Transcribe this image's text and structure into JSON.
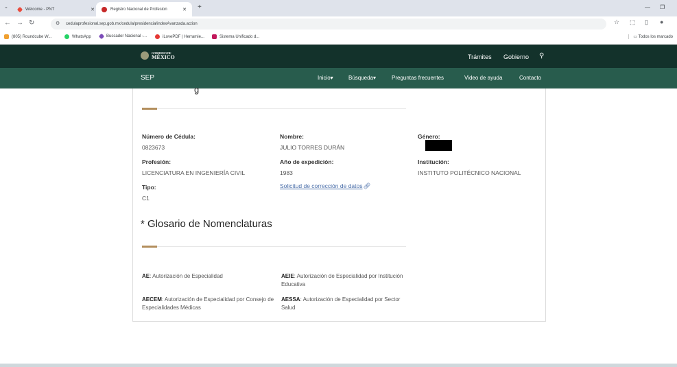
{
  "browser": {
    "tabs": [
      {
        "label": "Welcome - PNT",
        "active": false
      },
      {
        "label": "Registro Nacional de Profesion",
        "active": true
      }
    ],
    "url": "cedulaprofesional.sep.gob.mx/cedula/presidencia/indexAvanzada.action",
    "bookmarks": [
      "(805) Roundcube W...",
      "WhatsApp",
      "Buscador Nacional -...",
      "iLovePDF | Herramie...",
      "Sistema Unificado d..."
    ],
    "all_bookmarks": "Todos los marcado"
  },
  "header": {
    "logo_small": "GOBIERNO DE",
    "logo_main": "MÉXICO",
    "links": [
      "Trámites",
      "Gobierno"
    ],
    "sep": "SEP",
    "menu": [
      "Inicio▾",
      "Búsqueda▾",
      "Preguntas frecuentes",
      "Video de ayuda",
      "Contacto"
    ]
  },
  "record": {
    "heading_fragment": "g",
    "cedula_label": "Número de Cédula:",
    "cedula_value": "0823673",
    "nombre_label": "Nombre:",
    "nombre_value": "JULIO TORRES DURÁN",
    "genero_label": "Género:",
    "profesion_label": "Profesión:",
    "profesion_value": "LICENCIATURA EN INGENIERÍA CIVIL",
    "anio_label": "Año de expedición:",
    "anio_value": "1983",
    "institucion_label": "Institución:",
    "institucion_value": "INSTITUTO POLITÉCNICO NACIONAL",
    "tipo_label": "Tipo:",
    "tipo_value": "C1",
    "correction_link": "Solicitud de corrección de datos"
  },
  "glossary": {
    "title": "* Glosario de Nomenclaturas",
    "items": [
      {
        "code": "AE",
        "text": ": Autorización de Especialidad"
      },
      {
        "code": "AEIE",
        "text": ": Autorización de Especialidad por Institución Educativa"
      },
      {
        "code": "AECEM",
        "text": ": Autorización de Especialidad por Consejo de Especialidades Médicas"
      },
      {
        "code": "AESSA",
        "text": ": Autorización de Especialidad por Sector Salud"
      }
    ]
  }
}
